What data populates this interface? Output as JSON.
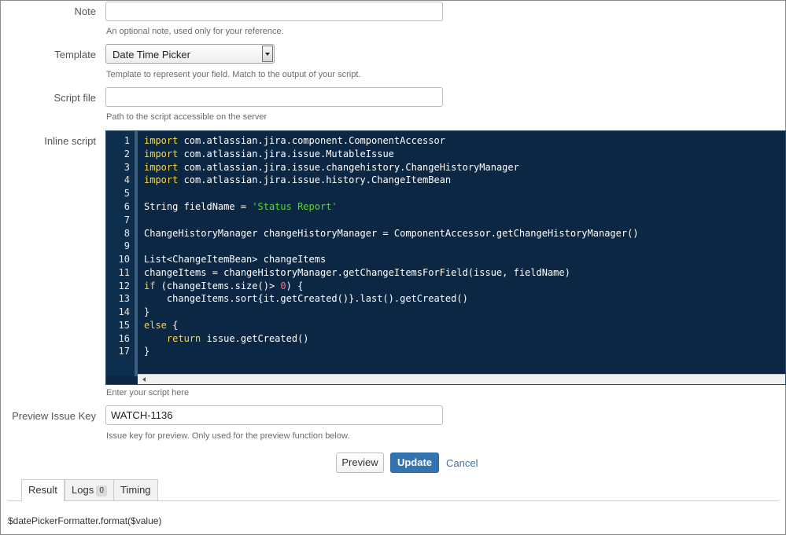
{
  "form": {
    "note": {
      "label": "Note",
      "value": "",
      "hint": "An optional note, used only for your reference."
    },
    "template": {
      "label": "Template",
      "selected": "Date Time Picker",
      "hint": "Template to represent your field. Match to the output of your script."
    },
    "script_file": {
      "label": "Script file",
      "value": "",
      "hint": "Path to the script accessible on the server"
    },
    "inline_script": {
      "label": "Inline script",
      "hint": "Enter your script here",
      "line_numbers": [
        "1",
        "2",
        "3",
        "4",
        "5",
        "6",
        "7",
        "8",
        "9",
        "10",
        "11",
        "12",
        "13",
        "14",
        "15",
        "16",
        "17"
      ],
      "lines": [
        "import com.atlassian.jira.component.ComponentAccessor",
        "import com.atlassian.jira.issue.MutableIssue",
        "import com.atlassian.jira.issue.changehistory.ChangeHistoryManager",
        "import com.atlassian.jira.issue.history.ChangeItemBean",
        "",
        "String fieldName = 'Status Report'",
        "",
        "ChangeHistoryManager changeHistoryManager = ComponentAccessor.getChangeHistoryManager()",
        "",
        "List<ChangeItemBean> changeItems",
        "changeItems = changeHistoryManager.getChangeItemsForField(issue, fieldName)",
        "if (changeItems.size()> 0) {",
        "    changeItems.sort{it.getCreated()}.last().getCreated()",
        "}",
        "else {",
        "    return issue.getCreated()",
        "}"
      ]
    },
    "preview_issue_key": {
      "label": "Preview Issue Key",
      "value": "WATCH-1136",
      "hint": "Issue key for preview. Only used for the preview function below."
    }
  },
  "actions": {
    "preview": "Preview",
    "update": "Update",
    "cancel": "Cancel"
  },
  "tabs": [
    {
      "label": "Result",
      "active": true
    },
    {
      "label": "Logs",
      "count": "0"
    },
    {
      "label": "Timing"
    }
  ],
  "result_text": "$datePickerFormatter.format($value)",
  "colors": {
    "editor_background": "#0b2743",
    "keyword": "#f3d64e",
    "string": "#58d63a",
    "number": "#ff6d80",
    "primary_button": "#3572b0",
    "link": "#3b73af"
  }
}
